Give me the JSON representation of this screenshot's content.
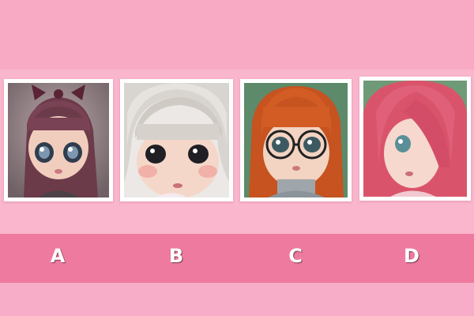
{
  "options": [
    {
      "label": "A",
      "description": "doll-brown-bob-bow"
    },
    {
      "label": "B",
      "description": "doll-platinum-bob"
    },
    {
      "label": "C",
      "description": "doll-orange-glasses"
    },
    {
      "label": "D",
      "description": "doll-pink-long-hair"
    }
  ],
  "colors": {
    "background": "#f7a9c4",
    "letter_strip": "#ef7aa0",
    "card_frame": "#ffffff",
    "letter_text": "#ffffff"
  }
}
